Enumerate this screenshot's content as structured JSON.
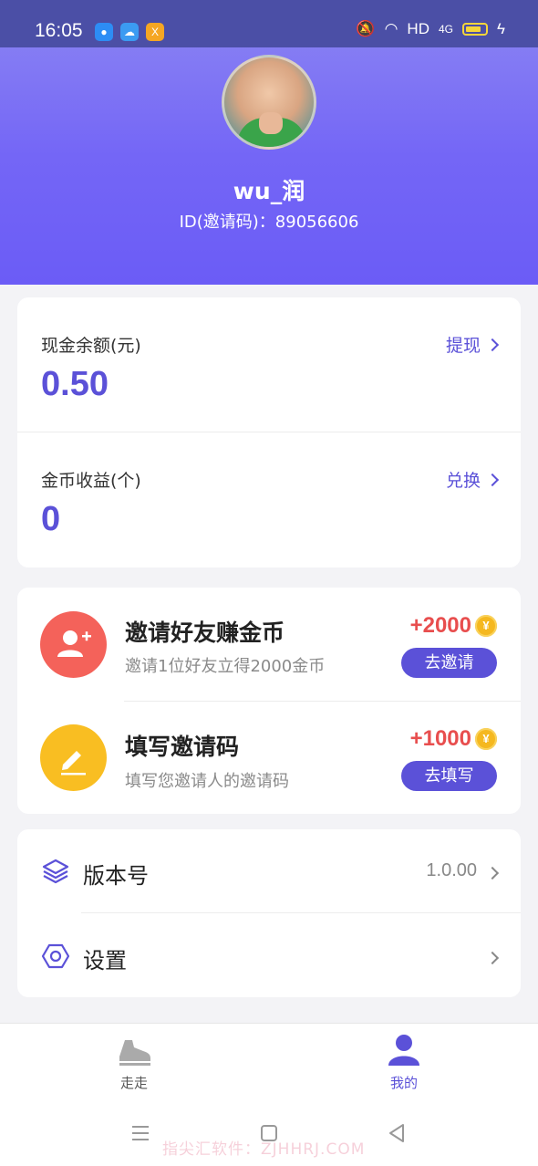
{
  "status_bar": {
    "time": "16:05",
    "network": "HD",
    "signal": "4G"
  },
  "profile": {
    "username": "wu_润",
    "id_label": "ID(邀请码)：89056606"
  },
  "balance": {
    "cash_label": "现金余额(元)",
    "cash_value": "0.50",
    "cash_action": "提现",
    "coin_label": "金币收益(个)",
    "coin_value": "0",
    "coin_action": "兑换"
  },
  "tasks": [
    {
      "title": "邀请好友赚金币",
      "desc": "邀请1位好友立得2000金币",
      "reward": "+2000",
      "button": "去邀请",
      "icon": "add-user-icon",
      "color": "#f4625a"
    },
    {
      "title": "填写邀请码",
      "desc": "填写您邀请人的邀请码",
      "reward": "+1000",
      "button": "去填写",
      "icon": "pencil-icon",
      "color": "#f9be22"
    }
  ],
  "coin_symbol": "¥",
  "menu": {
    "version_label": "版本号",
    "version_value": "1.0.00",
    "settings_label": "设置"
  },
  "tabbar": {
    "walk_label": "走走",
    "mine_label": "我的"
  },
  "watermark": "指尖汇软件：ZJHHRJ.COM",
  "colors": {
    "accent": "#5b51d8",
    "reward": "#e84e4e",
    "coin": "#f5b81f"
  }
}
